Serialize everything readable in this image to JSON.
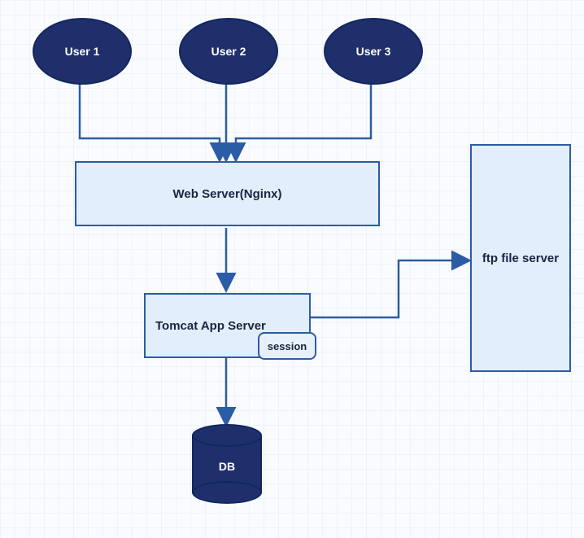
{
  "users": {
    "u1": "User 1",
    "u2": "User 2",
    "u3": "User 3"
  },
  "web_server": "Web Server(Nginx)",
  "app_server": "Tomcat App Server",
  "session": "session",
  "ftp": "ftp file server",
  "db": "DB"
}
